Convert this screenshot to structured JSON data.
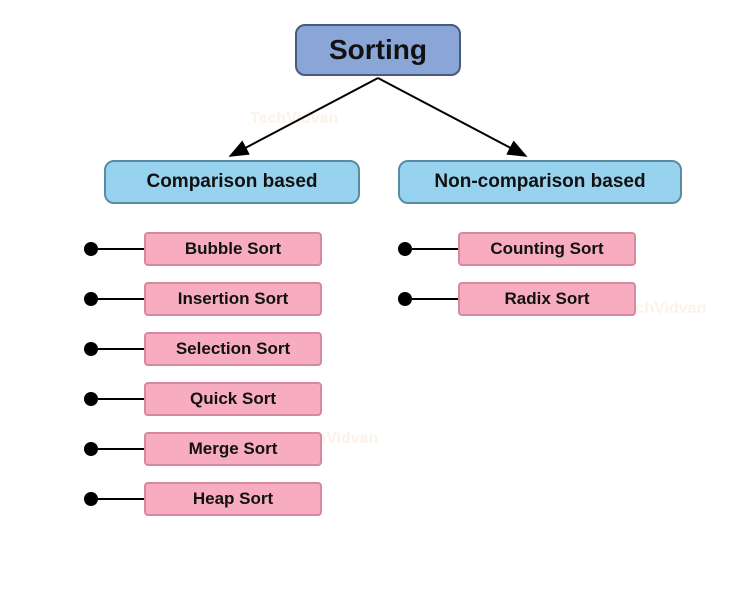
{
  "root": "Sorting",
  "categories": [
    {
      "label": "Comparison based"
    },
    {
      "label": "Non-comparison based"
    }
  ],
  "comparison_items": [
    "Bubble Sort",
    "Insertion Sort",
    "Selection Sort",
    "Quick Sort",
    "Merge Sort",
    "Heap Sort"
  ],
  "noncomparison_items": [
    "Counting Sort",
    "Radix Sort"
  ],
  "watermark": "TechVidvan"
}
